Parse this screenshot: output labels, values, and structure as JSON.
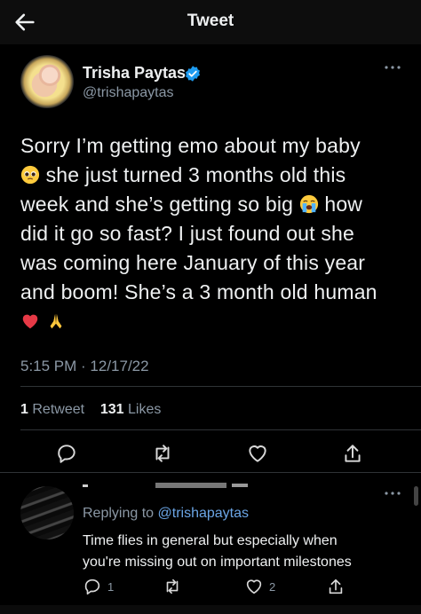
{
  "header": {
    "title": "Tweet",
    "back_icon": "arrow-left-icon"
  },
  "tweet": {
    "author_name": "Trisha Paytas",
    "handle": "@trishapaytas",
    "verified_icon": "verified-badge-icon",
    "more_icon": "more-horizontal-icon",
    "text_lines": [
      "Sorry I’m getting emo about my baby",
      "she just turned 3 months old this",
      "week and she’s getting so big",
      "how",
      "did it go so fast? I just found out she",
      "was coming here January of this year",
      "and boom! She’s a 3 month old human"
    ],
    "emojis": [
      "pleading-face-emoji",
      "loudly-crying-face-emoji",
      "red-heart-emoji",
      "folded-hands-emoji"
    ],
    "time": "5:15 PM",
    "date_separator": " · ",
    "date": "12/17/22",
    "retweets_count": "1",
    "retweets_label": "Retweet",
    "likes_count": "131",
    "likes_label": "Likes",
    "actions": [
      "reply-icon",
      "retweet-icon",
      "like-icon",
      "share-icon"
    ]
  },
  "reply": {
    "replying_prefix": "Replying to ",
    "replying_to": "@trishapaytas",
    "text_lines": [
      "Time flies in general but especially when",
      "you're missing out on important milestones"
    ],
    "reply_count": "1",
    "like_count": "2",
    "more_icon": "more-horizontal-icon"
  },
  "colors": {
    "background": "#000000",
    "text": "#eef0f1",
    "muted": "#8b98a5",
    "link": "#6ba5e5",
    "verified": "#1d9bf0"
  }
}
